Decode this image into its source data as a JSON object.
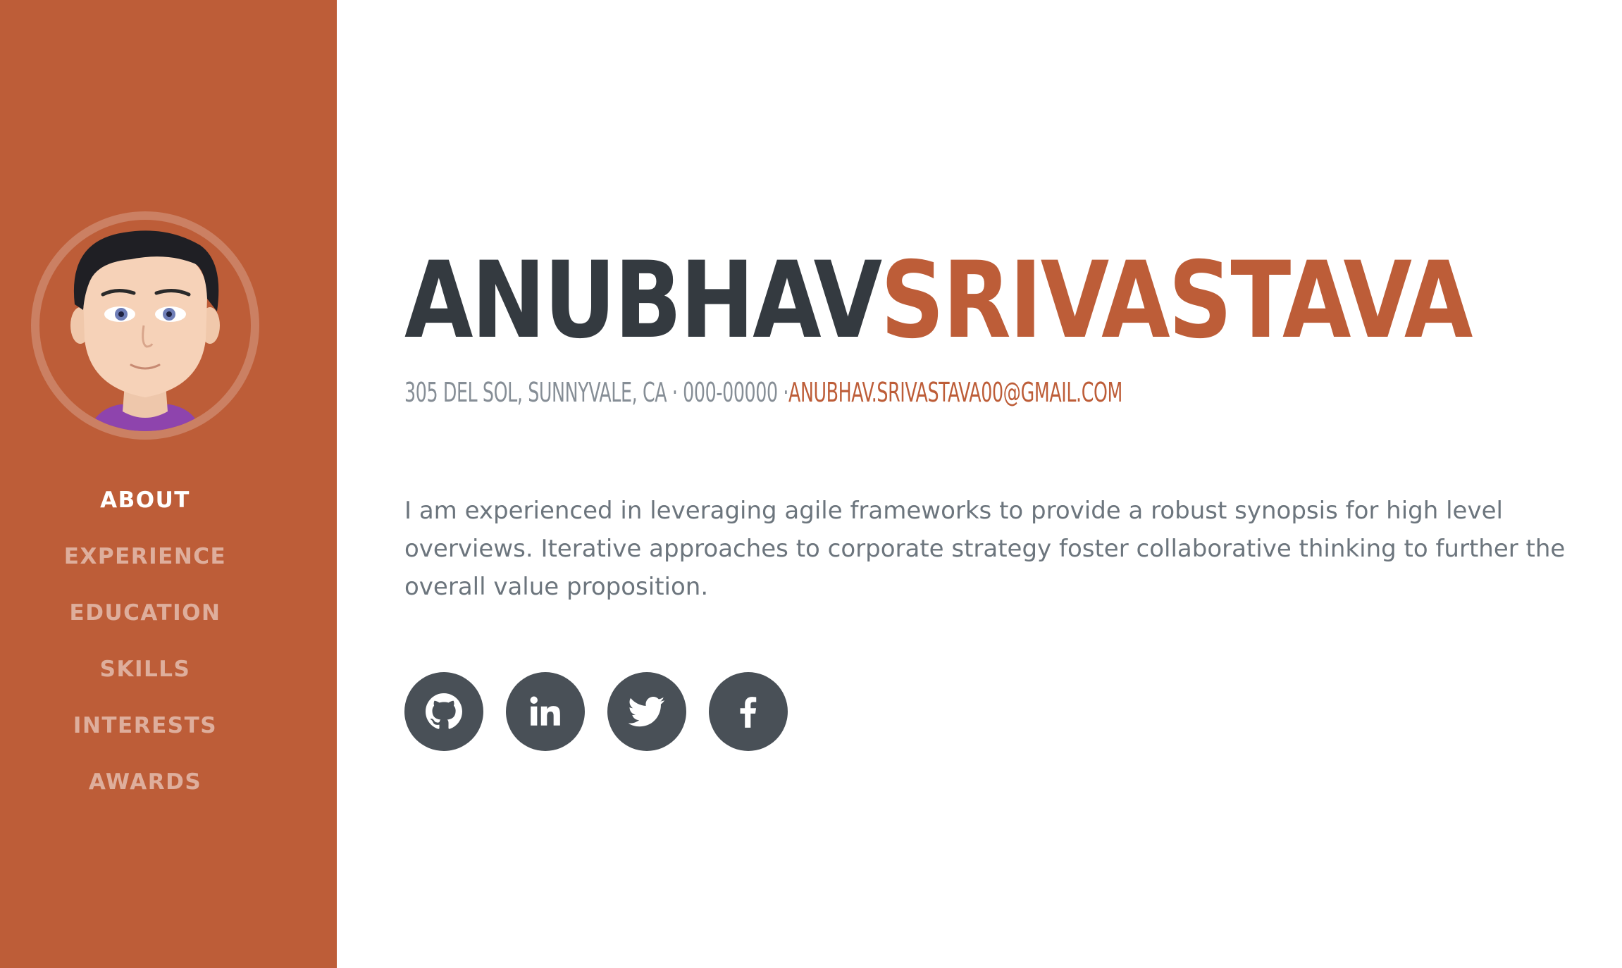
{
  "sidebar": {
    "avatar_alt": "avatar",
    "nav": [
      {
        "label": "ABOUT",
        "active": true
      },
      {
        "label": "EXPERIENCE",
        "active": false
      },
      {
        "label": "EDUCATION",
        "active": false
      },
      {
        "label": "SKILLS",
        "active": false
      },
      {
        "label": "INTERESTS",
        "active": false
      },
      {
        "label": "AWARDS",
        "active": false
      }
    ]
  },
  "about": {
    "first_name": "ANUBHAV",
    "last_name": "SRIVASTAVA",
    "address": "305 DEL SOL, SUNNYVALE, CA · 000-00000 ·",
    "email": "ANUBHAV.SRIVASTAVA00@GMAIL.COM",
    "bio": "I am experienced in leveraging agile frameworks to provide a robust synopsis for high level overviews. Iterative approaches to corporate strategy foster collaborative thinking to further the overall value proposition."
  },
  "social": [
    {
      "icon": "github-icon"
    },
    {
      "icon": "linkedin-icon"
    },
    {
      "icon": "twitter-icon"
    },
    {
      "icon": "facebook-icon"
    }
  ],
  "colors": {
    "primary": "#bd5d38",
    "dark": "#343a40",
    "muted": "#868e96",
    "social_bg": "#495057"
  }
}
